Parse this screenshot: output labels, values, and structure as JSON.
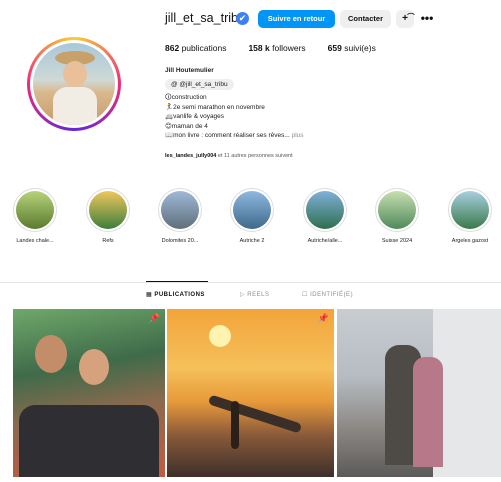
{
  "profile": {
    "username": "jill_et_sa_tribu",
    "verified_mark": "✔",
    "buttons": {
      "follow_back": "Suivre en retour",
      "contact": "Contacter",
      "add_user_glyph": "+͡",
      "more_glyph": "•••"
    },
    "stats": {
      "publications_count": "862",
      "publications_label": "publications",
      "followers_count": "158 k",
      "followers_label": "followers",
      "following_count": "659",
      "following_label": "suivi(e)s"
    },
    "bio": {
      "name": "Jill Houtemulier",
      "threads_handle": "@jill_et_sa_tribu",
      "lines": [
        "🛈construction",
        "🏃‍♀️2e semi marathon en novembre",
        "🚐vanlife & voyages",
        "😊maman de 4",
        "📖mon livre : comment réaliser ses rêves..."
      ],
      "more_label": "plus"
    },
    "followed_by": {
      "names": "les_landes_jully004",
      "rest": "et 11 autres personnes suivent"
    }
  },
  "highlights": [
    {
      "label": "Landes chale...",
      "colors": [
        "#b7d37a",
        "#5a7a2e"
      ]
    },
    {
      "label": "Refs",
      "colors": [
        "#f0c75e",
        "#3e7d3a"
      ]
    },
    {
      "label": "Dolomites 20...",
      "colors": [
        "#9fb8d8",
        "#5f6f7a"
      ]
    },
    {
      "label": "Autriche 2",
      "colors": [
        "#8fb7e0",
        "#3f6a8a"
      ]
    },
    {
      "label": "Autriche/alle...",
      "colors": [
        "#7fb0d8",
        "#2f6f4f"
      ]
    },
    {
      "label": "Suisse 2024",
      "colors": [
        "#c7dfb0",
        "#4f8a5a"
      ]
    },
    {
      "label": "Argeles gazost",
      "colors": [
        "#a8cfe0",
        "#3a7a4a"
      ]
    }
  ],
  "tabs": [
    {
      "icon": "▦",
      "label": "PUBLICATIONS",
      "active": true
    },
    {
      "icon": "▷",
      "label": "REELS",
      "active": false
    },
    {
      "icon": "☐",
      "label": "IDENTIFIÉ(E)",
      "active": false
    }
  ],
  "posts": [
    {
      "pinned": true
    },
    {
      "pinned": true
    },
    {
      "pinned": false
    }
  ],
  "colors": {
    "primary_button": "#0095f6",
    "secondary_button": "#efefef",
    "verified": "#3b82f6"
  }
}
